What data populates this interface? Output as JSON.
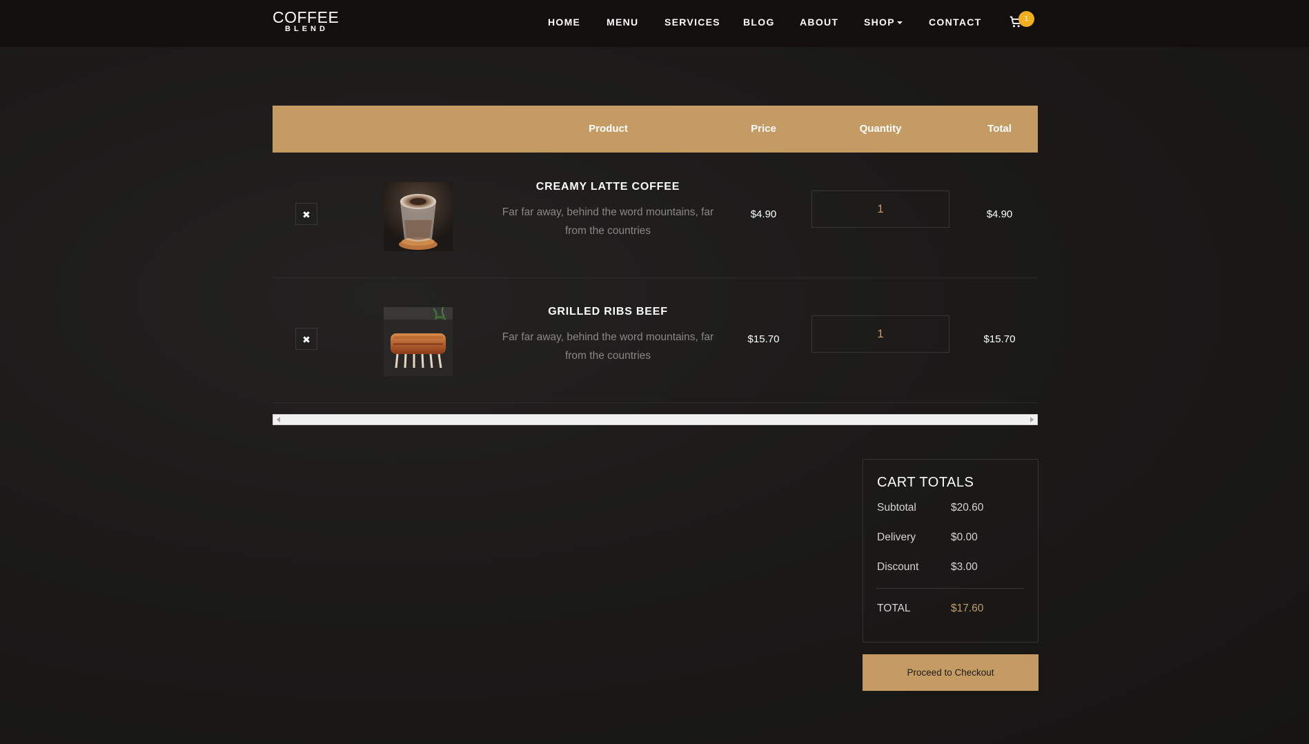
{
  "brand": {
    "name": "COFFEE",
    "tagline": "BLEND"
  },
  "nav": {
    "items": [
      "HOME",
      "MENU",
      "SERVICES",
      "BLOG",
      "ABOUT",
      "SHOP",
      "CONTACT"
    ],
    "cart_count": "1"
  },
  "table": {
    "headers": {
      "product": "Product",
      "price": "Price",
      "quantity": "Quantity",
      "total": "Total"
    },
    "rows": [
      {
        "title": "CREAMY LATTE COFFEE",
        "desc": "Far far away, behind the word mountains, far from the countries",
        "price": "$4.90",
        "qty": "1",
        "total": "$4.90",
        "image_icon": "latte-cup-photo"
      },
      {
        "title": "GRILLED RIBS BEEF",
        "desc": "Far far away, behind the word mountains, far from the countries",
        "price": "$15.70",
        "qty": "1",
        "total": "$15.70",
        "image_icon": "grilled-ribs-photo"
      }
    ]
  },
  "totals": {
    "title": "CART TOTALS",
    "subtotal_label": "Subtotal",
    "subtotal": "$20.60",
    "delivery_label": "Delivery",
    "delivery": "$0.00",
    "discount_label": "Discount",
    "discount": "$3.00",
    "total_label": "TOTAL",
    "total": "$17.60"
  },
  "checkout_label": "Proceed to Checkout",
  "colors": {
    "accent": "#c49b63",
    "badge": "#f2b01e",
    "background": "#1a1918",
    "navbar": "#120f0e"
  }
}
